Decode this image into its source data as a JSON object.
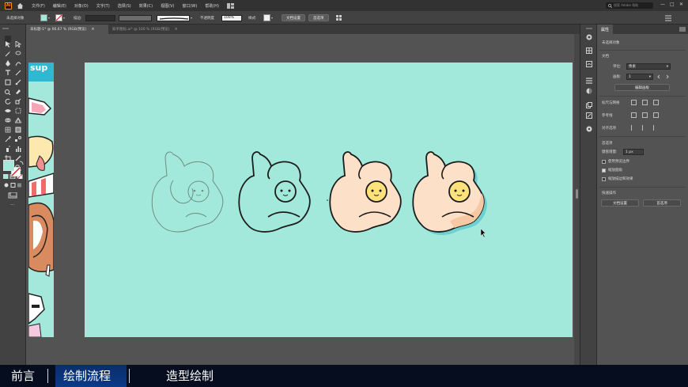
{
  "app": {
    "logo": "Ai",
    "menu": [
      "文件(F)",
      "编辑(E)",
      "对象(O)",
      "文字(T)",
      "选择(S)",
      "效果(C)",
      "视图(V)",
      "窗口(W)",
      "帮助(H)"
    ],
    "search_placeholder": "搜索 Adobe 帮助",
    "window_controls": [
      "—",
      "□",
      "✕"
    ]
  },
  "control_bar": {
    "selection_label": "未选择对象",
    "stroke_label": "描边:",
    "opacity_label": "不透明度",
    "opacity_value": "100%",
    "style_label": "样式:",
    "document_setup_button": "文档设置",
    "preferences_button": "首选项",
    "fill_color": "#a3e9db"
  },
  "tabs": [
    {
      "label": "未标题-1* @ 66.67 % (RGB/预览)",
      "close": "×",
      "active": true
    },
    {
      "label": "知乎图标.ai* @ 100 % (RGB/预览)",
      "close": "×",
      "active": false
    }
  ],
  "toolbar": {
    "fill_color": "#a3e9db",
    "more_label": "···"
  },
  "canvas": {
    "artboard_color": "#a3e9db",
    "strip_text": "sup",
    "hand_skin_color": "#fde0c8",
    "face_color": "#fde27b",
    "shadow_color": "#6bd0cf"
  },
  "properties": {
    "tab_label": "属性",
    "no_selection": "未选择对象",
    "document_section": "文档",
    "units_label": "单位:",
    "units_value": "像素",
    "artboard_label": "画板:",
    "artboard_value": "1",
    "edit_artboards_button": "编辑画板",
    "rulers_grids_label": "标尺与网格",
    "guides_label": "参考线",
    "align_label": "对齐选项",
    "preferences_section": "首选项",
    "keyboard_increment_label": "键盘增量:",
    "keyboard_increment_value": "1 px",
    "checkboxes": [
      {
        "label": "使用预览边界",
        "checked": false
      },
      {
        "label": "缩放圆角",
        "checked": true
      },
      {
        "label": "缩放描边和效果",
        "checked": false
      }
    ],
    "quick_actions_label": "快速操作",
    "document_setup_button": "文档设置",
    "preferences_button": "首选项"
  },
  "caption": {
    "items": [
      "前言",
      "绘制流程",
      "造型绘制"
    ],
    "highlight_color": "#0b3a88"
  }
}
